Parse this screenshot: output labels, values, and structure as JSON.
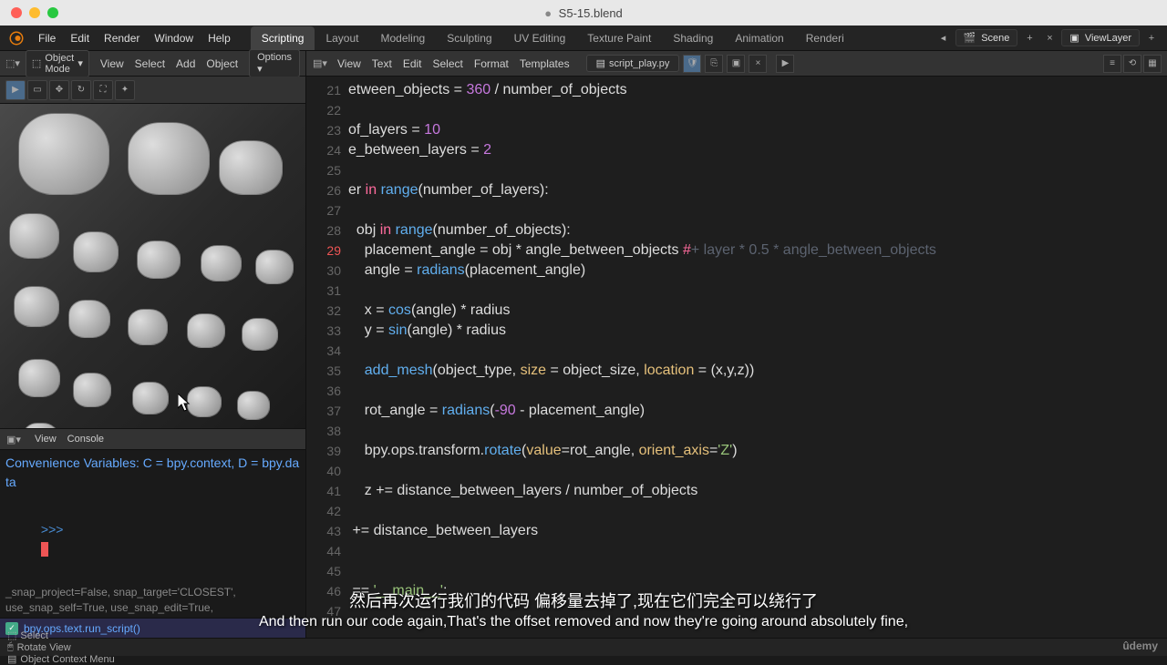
{
  "titlebar": {
    "filename": "S5-15.blend",
    "modified": true
  },
  "menubar": {
    "items": [
      "File",
      "Edit",
      "Render",
      "Window",
      "Help"
    ],
    "workspaces": [
      "Scripting",
      "Layout",
      "Modeling",
      "Sculpting",
      "UV Editing",
      "Texture Paint",
      "Shading",
      "Animation",
      "Renderi"
    ],
    "active_workspace": 0,
    "scene": "Scene",
    "viewlayer": "ViewLayer"
  },
  "viewport_header": {
    "mode": "Object Mode",
    "menus": [
      "View",
      "Select",
      "Add",
      "Object"
    ],
    "options": "Options"
  },
  "console": {
    "header_menus": [
      "View",
      "Console"
    ],
    "info_line": "Convenience Variables: C = bpy.context, D = bpy.data",
    "prompt": ">>> ",
    "history": "_snap_project=False, snap_target='CLOSEST', use_snap_self=True, use_snap_edit=True, use_snap_nonedit=True, use_snap_selectable=False)",
    "run_script": "bpy.ops.text.run_script()"
  },
  "editor": {
    "menus": [
      "View",
      "Text",
      "Edit",
      "Select",
      "Format",
      "Templates"
    ],
    "script_name": "script_play.py",
    "lines": [
      {
        "n": 21,
        "tokens": [
          [
            "etween_objects ",
            "id"
          ],
          [
            "= ",
            "op"
          ],
          [
            "360",
            "num"
          ],
          [
            " / ",
            "op"
          ],
          [
            "number_of_objects",
            "id"
          ]
        ]
      },
      {
        "n": 22,
        "tokens": []
      },
      {
        "n": 23,
        "tokens": [
          [
            "of_layers ",
            "id"
          ],
          [
            "= ",
            "op"
          ],
          [
            "10",
            "num"
          ]
        ]
      },
      {
        "n": 24,
        "tokens": [
          [
            "e_between_layers ",
            "id"
          ],
          [
            "= ",
            "op"
          ],
          [
            "2",
            "num"
          ]
        ]
      },
      {
        "n": 25,
        "tokens": []
      },
      {
        "n": 26,
        "tokens": [
          [
            "er ",
            "id"
          ],
          [
            "in",
            "kw"
          ],
          [
            " ",
            "op"
          ],
          [
            "range",
            "fn"
          ],
          [
            "(",
            "op"
          ],
          [
            "number_of_layers",
            "id"
          ],
          [
            "):",
            "op"
          ]
        ]
      },
      {
        "n": 27,
        "tokens": []
      },
      {
        "n": 28,
        "tokens": [
          [
            "  obj ",
            "id"
          ],
          [
            "in",
            "kw"
          ],
          [
            " ",
            "op"
          ],
          [
            "range",
            "fn"
          ],
          [
            "(",
            "op"
          ],
          [
            "number_of_objects",
            "id"
          ],
          [
            "):",
            "op"
          ]
        ]
      },
      {
        "n": 29,
        "hl": true,
        "tokens": [
          [
            "    placement_angle ",
            "id"
          ],
          [
            "= ",
            "op"
          ],
          [
            "obj ",
            "id"
          ],
          [
            "* ",
            "op"
          ],
          [
            "angle_between_objects ",
            "id"
          ],
          [
            "#",
            "kw"
          ],
          [
            "+ layer * 0.5 * angle_between_objects",
            "cm"
          ]
        ]
      },
      {
        "n": 30,
        "tokens": [
          [
            "    angle ",
            "id"
          ],
          [
            "= ",
            "op"
          ],
          [
            "radians",
            "fn"
          ],
          [
            "(",
            "op"
          ],
          [
            "placement_angle",
            "id"
          ],
          [
            ")",
            "op"
          ]
        ]
      },
      {
        "n": 31,
        "tokens": []
      },
      {
        "n": 32,
        "tokens": [
          [
            "    x ",
            "id"
          ],
          [
            "= ",
            "op"
          ],
          [
            "cos",
            "fn"
          ],
          [
            "(",
            "op"
          ],
          [
            "angle",
            "id"
          ],
          [
            ") ",
            "op"
          ],
          [
            "* ",
            "op"
          ],
          [
            "radius",
            "id"
          ]
        ]
      },
      {
        "n": 33,
        "tokens": [
          [
            "    y ",
            "id"
          ],
          [
            "= ",
            "op"
          ],
          [
            "sin",
            "fn"
          ],
          [
            "(",
            "op"
          ],
          [
            "angle",
            "id"
          ],
          [
            ") ",
            "op"
          ],
          [
            "* ",
            "op"
          ],
          [
            "radius",
            "id"
          ]
        ]
      },
      {
        "n": 34,
        "tokens": []
      },
      {
        "n": 35,
        "tokens": [
          [
            "    add_mesh",
            "fn"
          ],
          [
            "(",
            "op"
          ],
          [
            "object_type",
            "id"
          ],
          [
            ", ",
            "op"
          ],
          [
            "size",
            "param"
          ],
          [
            " = ",
            "op"
          ],
          [
            "object_size",
            "id"
          ],
          [
            ", ",
            "op"
          ],
          [
            "location",
            "param"
          ],
          [
            " = (",
            "op"
          ],
          [
            "x",
            "id"
          ],
          [
            ",",
            "op"
          ],
          [
            "y",
            "id"
          ],
          [
            ",",
            "op"
          ],
          [
            "z",
            "id"
          ],
          [
            "))",
            "op"
          ]
        ]
      },
      {
        "n": 36,
        "tokens": []
      },
      {
        "n": 37,
        "tokens": [
          [
            "    rot_angle ",
            "id"
          ],
          [
            "= ",
            "op"
          ],
          [
            "radians",
            "fn"
          ],
          [
            "(",
            "op"
          ],
          [
            "-90",
            "num"
          ],
          [
            " - ",
            "op"
          ],
          [
            "placement_angle",
            "id"
          ],
          [
            ")",
            "op"
          ]
        ]
      },
      {
        "n": 38,
        "tokens": []
      },
      {
        "n": 39,
        "tokens": [
          [
            "    bpy",
            "id"
          ],
          [
            ".",
            "op"
          ],
          [
            "ops",
            "id"
          ],
          [
            ".",
            "op"
          ],
          [
            "transform",
            "id"
          ],
          [
            ".",
            "op"
          ],
          [
            "rotate",
            "fn"
          ],
          [
            "(",
            "op"
          ],
          [
            "value",
            "param"
          ],
          [
            "=",
            "op"
          ],
          [
            "rot_angle",
            "id"
          ],
          [
            ", ",
            "op"
          ],
          [
            "orient_axis",
            "param"
          ],
          [
            "=",
            "op"
          ],
          [
            "'Z'",
            "str"
          ],
          [
            ")",
            "op"
          ]
        ]
      },
      {
        "n": 40,
        "tokens": []
      },
      {
        "n": 41,
        "tokens": [
          [
            "    z ",
            "id"
          ],
          [
            "+= ",
            "op"
          ],
          [
            "distance_between_layers ",
            "id"
          ],
          [
            "/ ",
            "op"
          ],
          [
            "number_of_objects",
            "id"
          ]
        ]
      },
      {
        "n": 42,
        "tokens": []
      },
      {
        "n": 43,
        "tokens": [
          [
            " += ",
            "op"
          ],
          [
            "distance_between_layers",
            "id"
          ]
        ]
      },
      {
        "n": 44,
        "tokens": []
      },
      {
        "n": 45,
        "tokens": []
      },
      {
        "n": 46,
        "tokens": [
          [
            " == ",
            "op"
          ],
          [
            "'__main__'",
            "str"
          ],
          [
            ":",
            "op"
          ]
        ]
      },
      {
        "n": 47,
        "tokens": []
      }
    ]
  },
  "statusbar": {
    "items": [
      "Select",
      "Rotate View",
      "Object Context Menu"
    ]
  },
  "subtitles": {
    "cn": "然后再次运行我们的代码 偏移量去掉了,现在它们完全可以绕行了",
    "en": "And then run our code again,That's the offset removed and now they're going around absolutely fine,"
  },
  "udemy": "ûdemy"
}
